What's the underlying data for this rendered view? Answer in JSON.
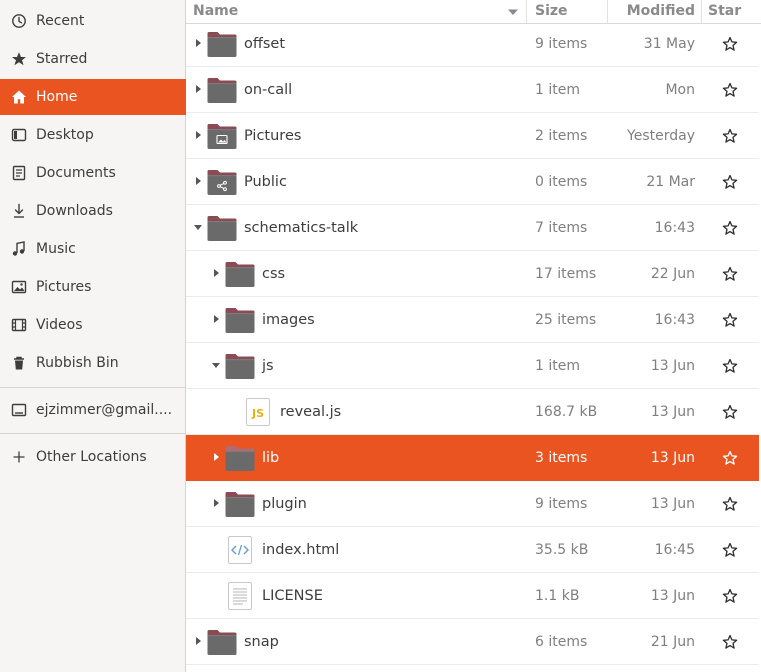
{
  "sidebar": {
    "items": [
      {
        "label": "Recent",
        "icon": "recent-clock-icon"
      },
      {
        "label": "Starred",
        "icon": "star-filled-icon"
      },
      {
        "label": "Home",
        "icon": "home-icon",
        "active": true
      },
      {
        "label": "Desktop",
        "icon": "desktop-icon"
      },
      {
        "label": "Documents",
        "icon": "documents-icon"
      },
      {
        "label": "Downloads",
        "icon": "downloads-icon"
      },
      {
        "label": "Music",
        "icon": "music-icon"
      },
      {
        "label": "Pictures",
        "icon": "pictures-icon"
      },
      {
        "label": "Videos",
        "icon": "videos-icon"
      },
      {
        "label": "Rubbish Bin",
        "icon": "trash-icon"
      }
    ],
    "account": {
      "label": "ejzimmer@gmail....",
      "icon": "online-account-icon"
    },
    "other": {
      "label": "Other Locations",
      "icon": "plus-icon"
    }
  },
  "columns": {
    "name": "Name",
    "size": "Size",
    "modified": "Modified",
    "star": "Star"
  },
  "files": [
    {
      "name": "offset",
      "size": "9 items",
      "modified": "31 May",
      "type": "folder",
      "depth": 0,
      "expander": "collapsed"
    },
    {
      "name": "on-call",
      "size": "1 item",
      "modified": "Mon",
      "type": "folder",
      "depth": 0,
      "expander": "collapsed"
    },
    {
      "name": "Pictures",
      "size": "2 items",
      "modified": "Yesterday",
      "type": "folder-pictures",
      "depth": 0,
      "expander": "collapsed"
    },
    {
      "name": "Public",
      "size": "0 items",
      "modified": "21 Mar",
      "type": "folder-public",
      "depth": 0,
      "expander": "collapsed"
    },
    {
      "name": "schematics-talk",
      "size": "7 items",
      "modified": "16:43",
      "type": "folder",
      "depth": 0,
      "expander": "expanded"
    },
    {
      "name": "css",
      "size": "17 items",
      "modified": "22 Jun",
      "type": "folder",
      "depth": 1,
      "expander": "collapsed"
    },
    {
      "name": "images",
      "size": "25 items",
      "modified": "16:43",
      "type": "folder",
      "depth": 1,
      "expander": "collapsed"
    },
    {
      "name": "js",
      "size": "1 item",
      "modified": "13 Jun",
      "type": "folder",
      "depth": 1,
      "expander": "expanded"
    },
    {
      "name": "reveal.js",
      "size": "168.7 kB",
      "modified": "13 Jun",
      "type": "javascript",
      "depth": 2,
      "expander": "none",
      "icon_text": "JS"
    },
    {
      "name": "lib",
      "size": "3 items",
      "modified": "13 Jun",
      "type": "folder",
      "depth": 1,
      "expander": "collapsed",
      "selected": true
    },
    {
      "name": "plugin",
      "size": "9 items",
      "modified": "13 Jun",
      "type": "folder",
      "depth": 1,
      "expander": "collapsed"
    },
    {
      "name": "index.html",
      "size": "35.5 kB",
      "modified": "16:45",
      "type": "html",
      "depth": 1,
      "expander": "none"
    },
    {
      "name": "LICENSE",
      "size": "1.1 kB",
      "modified": "13 Jun",
      "type": "text",
      "depth": 1,
      "expander": "none"
    },
    {
      "name": "snap",
      "size": "6 items",
      "modified": "21 Jun",
      "type": "folder",
      "depth": 0,
      "expander": "collapsed"
    }
  ],
  "colors": {
    "accent": "#e95420",
    "folder_body": "#6a6a6a",
    "folder_tab": "#8c4a55"
  }
}
